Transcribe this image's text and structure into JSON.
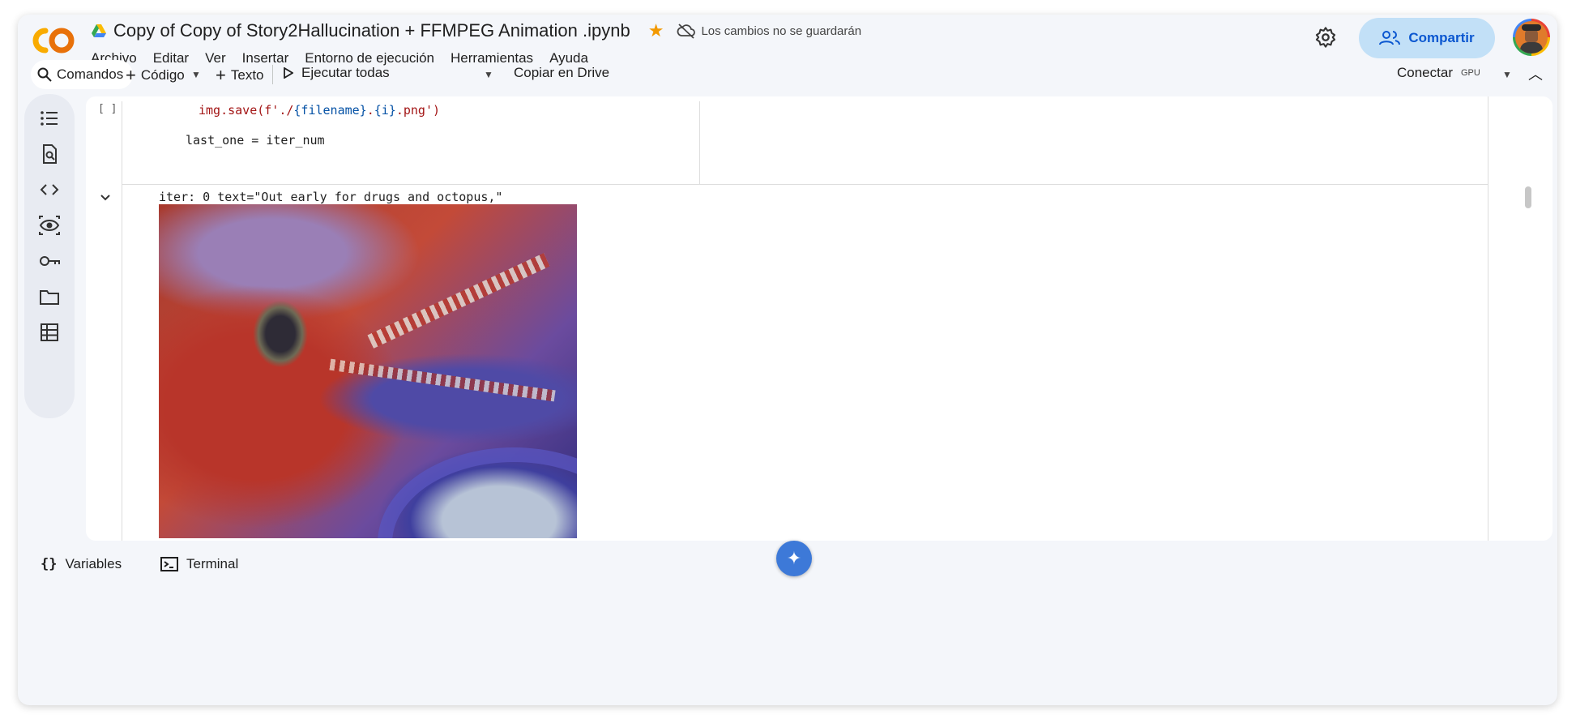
{
  "header": {
    "title": "Copy of Copy of Story2Hallucination + FFMPEG Animation .ipynb",
    "unsaved_notice": "Los cambios no se guardarán",
    "share_label": "Compartir",
    "menu": [
      "Archivo",
      "Editar",
      "Ver",
      "Insertar",
      "Entorno de ejecución",
      "Herramientas",
      "Ayuda"
    ]
  },
  "toolbar": {
    "commands_label": "Comandos",
    "code_label": "Código",
    "text_label": "Texto",
    "run_all_label": "Ejecutar todas",
    "copy_drive_label": "Copiar en Drive",
    "connect_label": "Conectar",
    "gpu_label": "GPU"
  },
  "cell": {
    "bracket": "[ ]",
    "code_line_1_prefix": "img.save(f'./",
    "code_line_1_var": "{filename}",
    "code_line_1_mid": ".",
    "code_line_1_var2": "{i}",
    "code_line_1_suffix": ".png')",
    "code_line_2": "last_one = iter_num"
  },
  "output": {
    "text": "iter: 0 text=\"Out early for drugs and octopus,\""
  },
  "bottom": {
    "variables_label": "Variables",
    "terminal_label": "Terminal"
  },
  "colors": {
    "accent": "#0b57d0",
    "share_bg": "#c2e0f7",
    "star": "#f29900"
  },
  "icons": [
    "colab-logo",
    "drive-icon",
    "star-icon",
    "cloud-off-icon",
    "settings-icon",
    "people-icon",
    "avatar",
    "search-icon",
    "plus-icon",
    "play-icon",
    "chevron-down-icon",
    "chevron-up-icon",
    "toc-icon",
    "find-icon",
    "code-icon",
    "eye-icon",
    "key-icon",
    "folder-icon",
    "table-icon",
    "braces-icon",
    "terminal-icon",
    "gemini-icon"
  ]
}
